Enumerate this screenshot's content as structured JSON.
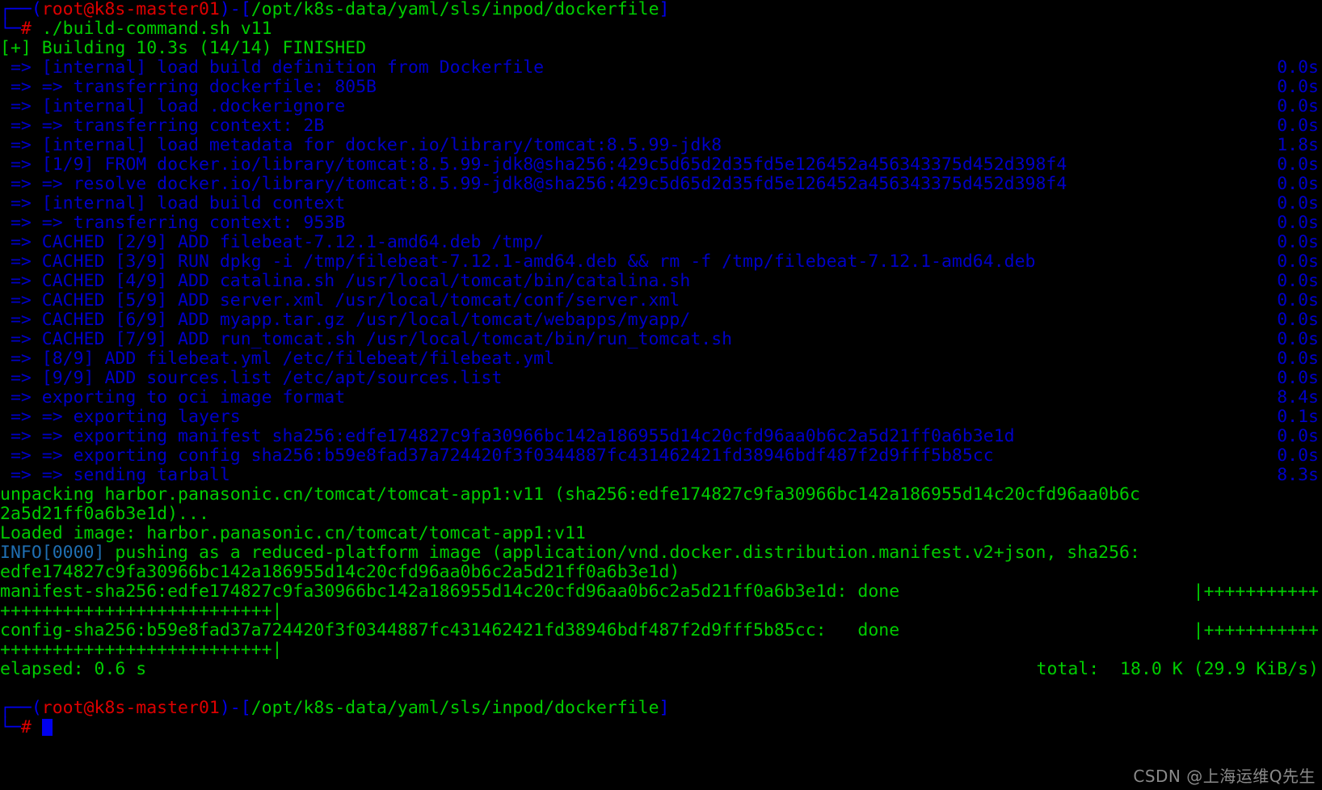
{
  "terminal": {
    "background_color": "#000000",
    "colors": {
      "green": "#00cc00",
      "bright_green": "#00e000",
      "buildkit_blue": "#0000c8",
      "prompt_blue": "#0000ee",
      "prompt_red": "#dd0000",
      "info_blue": "#1f6fb2",
      "watermark_gray": "#8a8a8a"
    },
    "prompt_top": {
      "bracket_open": "┌──(",
      "user_host": "root@k8s-master01",
      "bracket_mid": ")-[",
      "path": "/opt/k8s-data/yaml/sls/inpod/dockerfile",
      "bracket_close": "]"
    },
    "prompt_bottom": {
      "corner": "└─",
      "symbol": "#",
      "command": "./build-command.sh v11"
    },
    "final_prompt": {
      "corner": "└─",
      "symbol": "#",
      "command": ""
    },
    "build_header": "[+] Building 10.3s (14/14) FINISHED",
    "build_steps": [
      {
        "arrow": " => ",
        "text": "[internal] load build definition from Dockerfile",
        "duration": "0.0s"
      },
      {
        "arrow": " => => ",
        "text": "transferring dockerfile: 805B",
        "duration": "0.0s"
      },
      {
        "arrow": " => ",
        "text": "[internal] load .dockerignore",
        "duration": "0.0s"
      },
      {
        "arrow": " => => ",
        "text": "transferring context: 2B",
        "duration": "0.0s"
      },
      {
        "arrow": " => ",
        "text": "[internal] load metadata for docker.io/library/tomcat:8.5.99-jdk8",
        "duration": "1.8s"
      },
      {
        "arrow": " => ",
        "text": "[1/9] FROM docker.io/library/tomcat:8.5.99-jdk8@sha256:429c5d65d2d35fd5e126452a456343375d452d398f4",
        "duration": "0.0s"
      },
      {
        "arrow": " => => ",
        "text": "resolve docker.io/library/tomcat:8.5.99-jdk8@sha256:429c5d65d2d35fd5e126452a456343375d452d398f4",
        "duration": "0.0s"
      },
      {
        "arrow": " => ",
        "text": "[internal] load build context",
        "duration": "0.0s"
      },
      {
        "arrow": " => => ",
        "text": "transferring context: 953B",
        "duration": "0.0s"
      },
      {
        "arrow": " => ",
        "text": "CACHED [2/9] ADD filebeat-7.12.1-amd64.deb /tmp/",
        "duration": "0.0s"
      },
      {
        "arrow": " => ",
        "text": "CACHED [3/9] RUN dpkg -i /tmp/filebeat-7.12.1-amd64.deb && rm -f /tmp/filebeat-7.12.1-amd64.deb",
        "duration": "0.0s"
      },
      {
        "arrow": " => ",
        "text": "CACHED [4/9] ADD catalina.sh /usr/local/tomcat/bin/catalina.sh",
        "duration": "0.0s"
      },
      {
        "arrow": " => ",
        "text": "CACHED [5/9] ADD server.xml /usr/local/tomcat/conf/server.xml",
        "duration": "0.0s"
      },
      {
        "arrow": " => ",
        "text": "CACHED [6/9] ADD myapp.tar.gz /usr/local/tomcat/webapps/myapp/",
        "duration": "0.0s"
      },
      {
        "arrow": " => ",
        "text": "CACHED [7/9] ADD run_tomcat.sh /usr/local/tomcat/bin/run_tomcat.sh",
        "duration": "0.0s"
      },
      {
        "arrow": " => ",
        "text": "[8/9] ADD filebeat.yml /etc/filebeat/filebeat.yml",
        "duration": "0.0s"
      },
      {
        "arrow": " => ",
        "text": "[9/9] ADD sources.list /etc/apt/sources.list",
        "duration": "0.0s"
      },
      {
        "arrow": " => ",
        "text": "exporting to oci image format",
        "duration": "8.4s"
      },
      {
        "arrow": " => => ",
        "text": "exporting layers",
        "duration": "0.1s"
      },
      {
        "arrow": " => => ",
        "text": "exporting manifest sha256:edfe174827c9fa30966bc142a186955d14c20cfd96aa0b6c2a5d21ff0a6b3e1d",
        "duration": "0.0s"
      },
      {
        "arrow": " => => ",
        "text": "exporting config sha256:b59e8fad37a724420f3f0344887fc431462421fd38946bdf487f2d9fff5b85cc",
        "duration": "0.0s"
      },
      {
        "arrow": " => => ",
        "text": "sending tarball",
        "duration": "8.3s"
      }
    ],
    "output_lines": [
      {
        "id": "unpacking-line-1",
        "text": "unpacking harbor.panasonic.cn/tomcat/tomcat-app1:v11 (sha256:edfe174827c9fa30966bc142a186955d14c20cfd96aa0b6c",
        "color": "green"
      },
      {
        "id": "unpacking-line-2",
        "text": "2a5d21ff0a6b3e1d)...",
        "color": "green"
      },
      {
        "id": "loaded-image-line",
        "text": "Loaded image: harbor.panasonic.cn/tomcat/tomcat-app1:v11",
        "color": "green"
      },
      {
        "id": "info-line-1-prefix",
        "text": "INFO[0000]",
        "color": "info"
      },
      {
        "id": "info-line-1-body",
        "text": " pushing as a reduced-platform image (application/vnd.docker.distribution.manifest.v2+json, sha256:",
        "color": "green"
      },
      {
        "id": "info-line-2",
        "text": "edfe174827c9fa30966bc142a186955d14c20cfd96aa0b6c2a5d21ff0a6b3e1d)",
        "color": "green"
      },
      {
        "id": "manifest-progress-line",
        "text": "manifest-sha256:edfe174827c9fa30966bc142a186955d14c20cfd96aa0b6c2a5d21ff0a6b3e1d: done",
        "color": "green"
      },
      {
        "id": "manifest-progress-bar-right",
        "text": "|+++++++++++",
        "color": "green"
      },
      {
        "id": "manifest-progress-bar-wrap",
        "text": "++++++++++++++++++++++++++|",
        "color": "green"
      },
      {
        "id": "config-progress-line",
        "text": "config-sha256:b59e8fad37a724420f3f0344887fc431462421fd38946bdf487f2d9fff5b85cc:   done",
        "color": "green"
      },
      {
        "id": "config-progress-bar-right",
        "text": "|+++++++++++",
        "color": "green"
      },
      {
        "id": "config-progress-bar-wrap",
        "text": "++++++++++++++++++++++++++|",
        "color": "green"
      },
      {
        "id": "elapsed-line",
        "text": "elapsed: 0.6 s",
        "color": "green"
      },
      {
        "id": "total-line",
        "text": "total:  18.0 K (29.9 KiB/s)",
        "color": "green"
      }
    ],
    "watermark": "CSDN @上海运维Q先生"
  }
}
